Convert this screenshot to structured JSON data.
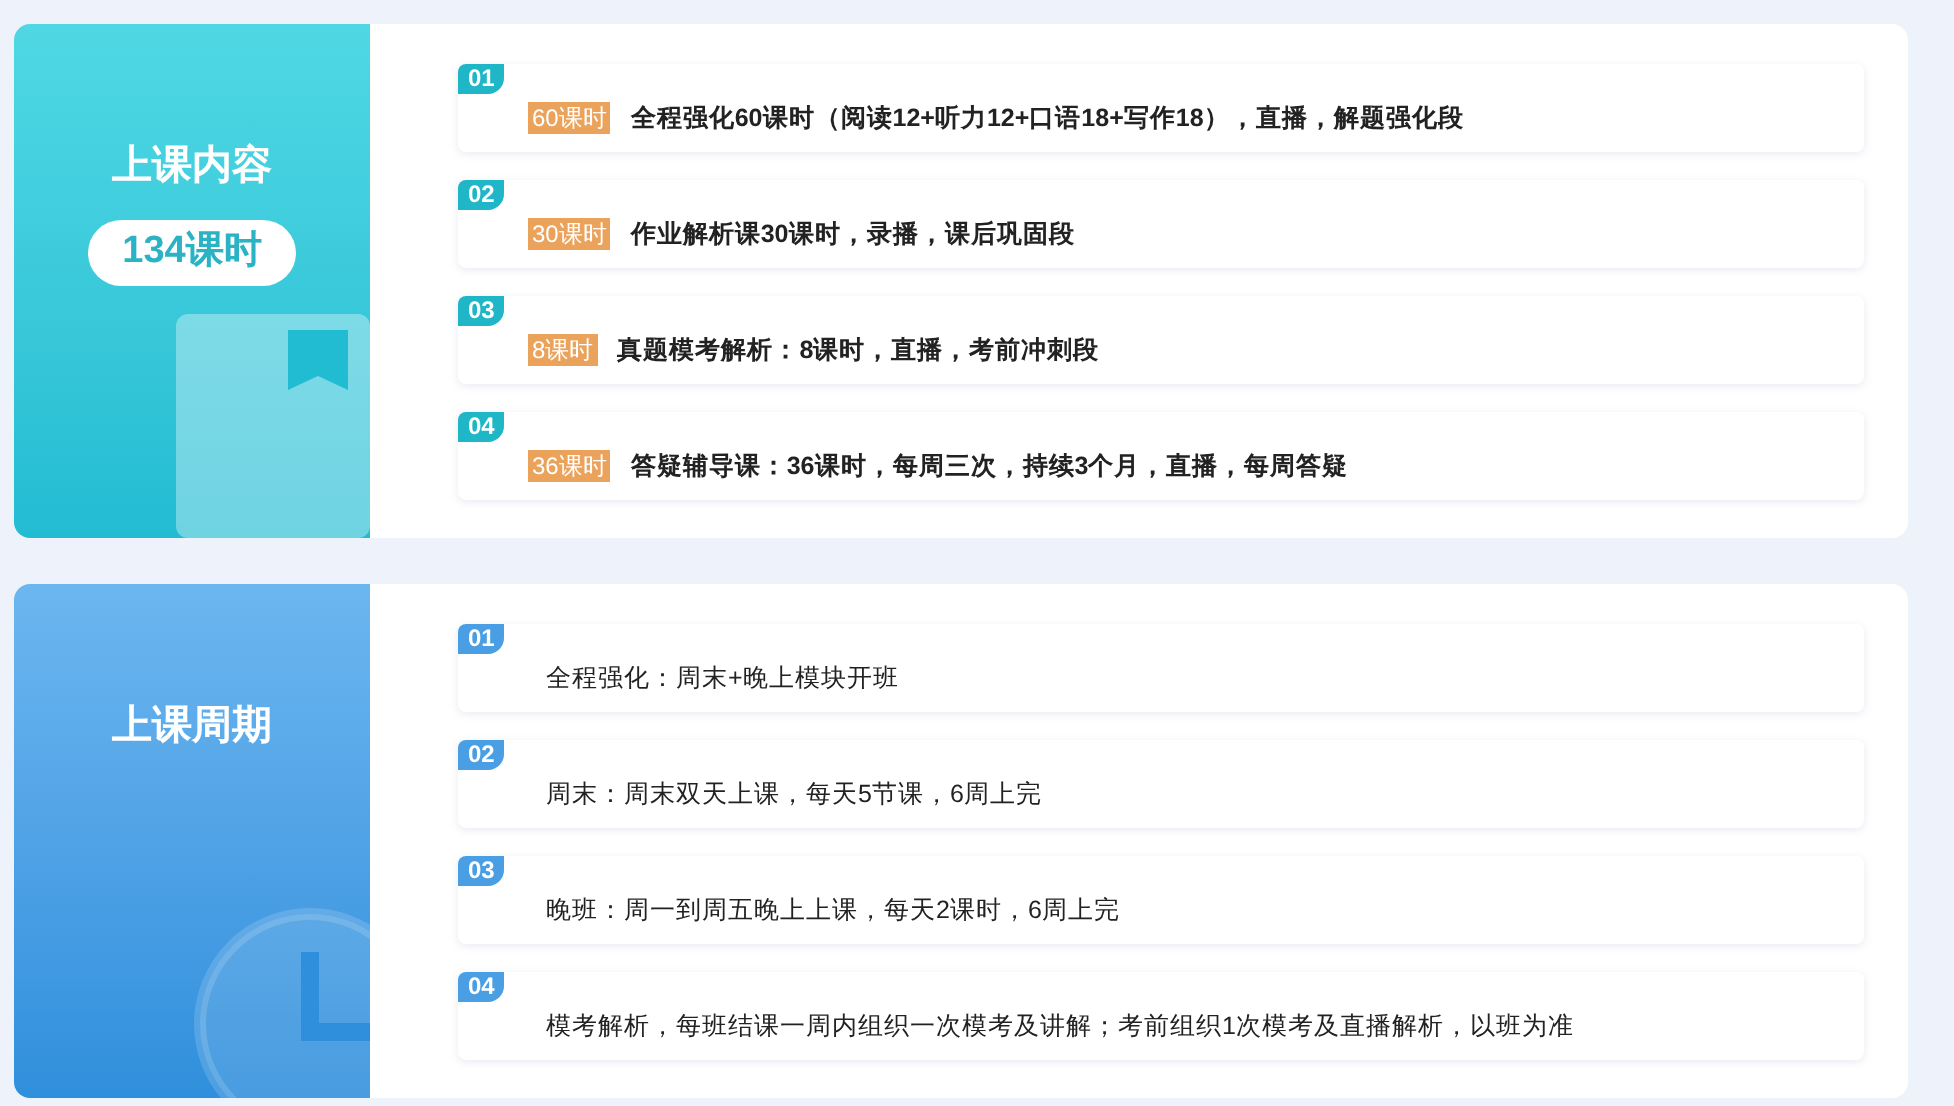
{
  "sections": [
    {
      "kind": "content",
      "title": "上课内容",
      "badge": "134课时",
      "rows": [
        {
          "number": "01",
          "tag": "60课时",
          "text": "全程强化60课时（阅读12+听力12+口语18+写作18），直播，解题强化段"
        },
        {
          "number": "02",
          "tag": "30课时",
          "text": "作业解析课30课时，录播，课后巩固段"
        },
        {
          "number": "03",
          "tag": "8课时",
          "text": "真题模考解析：8课时，直播，考前冲刺段"
        },
        {
          "number": "04",
          "tag": "36课时",
          "text": "答疑辅导课：36课时，每周三次，持续3个月，直播，每周答疑"
        }
      ]
    },
    {
      "kind": "schedule",
      "title": "上课周期",
      "rows": [
        {
          "number": "01",
          "text": "全程强化：周末+晚上模块开班"
        },
        {
          "number": "02",
          "text": "周末：周末双天上课，每天5节课，6周上完"
        },
        {
          "number": "03",
          "text": "晚班：周一到周五晚上上课，每天2课时，6周上完"
        },
        {
          "number": "04",
          "text": "模考解析，每班结课一周内组织一次模考及讲解；考前组织1次模考及直播解析，以班为准"
        }
      ]
    }
  ]
}
